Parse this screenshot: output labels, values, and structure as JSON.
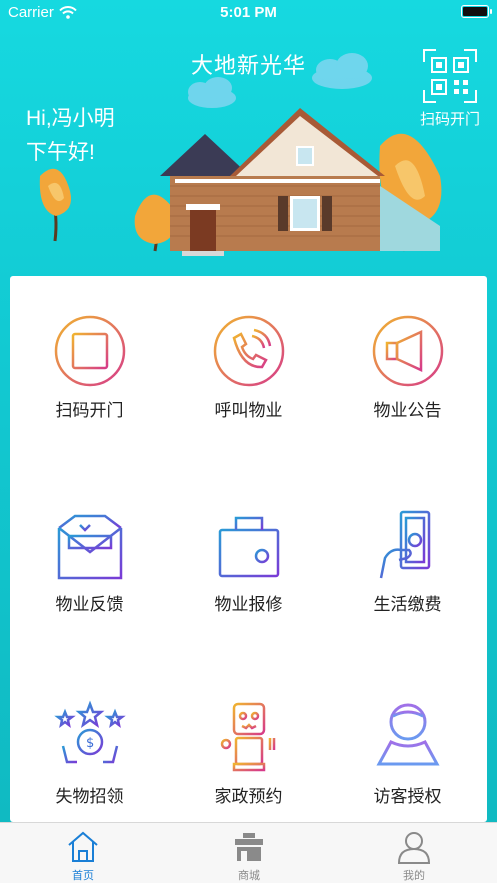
{
  "status_bar": {
    "carrier": "Carrier",
    "time": "5:01 PM"
  },
  "header": {
    "title": "大地新光华",
    "greeting_line1": "Hi,冯小明",
    "greeting_line2": "下午好!",
    "scan_label": "扫码开门"
  },
  "services": [
    {
      "label": "扫码开门",
      "icon": "scan-frame-icon"
    },
    {
      "label": "呼叫物业",
      "icon": "phone-call-icon"
    },
    {
      "label": "物业公告",
      "icon": "speaker-icon"
    },
    {
      "label": "物业反馈",
      "icon": "feedback-envelope-icon"
    },
    {
      "label": "物业报修",
      "icon": "toolbox-icon"
    },
    {
      "label": "生活缴费",
      "icon": "pay-bill-icon"
    },
    {
      "label": "失物招领",
      "icon": "lost-found-icon"
    },
    {
      "label": "家政预约",
      "icon": "robot-icon"
    },
    {
      "label": "访客授权",
      "icon": "visitor-icon"
    }
  ],
  "tabbar": {
    "tabs": [
      {
        "label": "首页",
        "icon": "home-icon",
        "active": true
      },
      {
        "label": "商城",
        "icon": "shop-icon",
        "active": false
      },
      {
        "label": "我的",
        "icon": "user-icon",
        "active": false
      }
    ]
  },
  "colors": {
    "accent": "#1a7fd6",
    "header_bg": "#16d9e0",
    "gradient_start": "#f0b430",
    "gradient_end": "#d63a8a",
    "gradient_blue": "#3a6cd6"
  }
}
